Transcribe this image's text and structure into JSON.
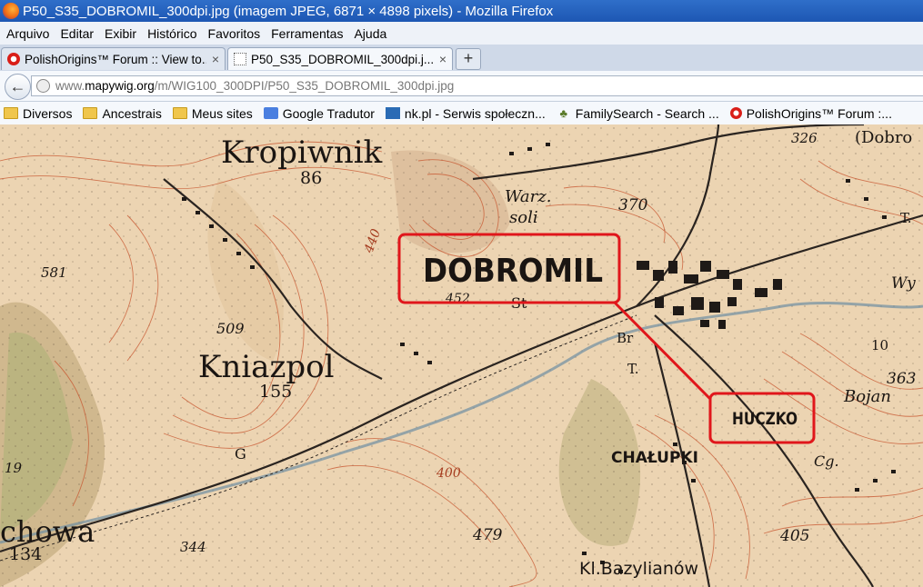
{
  "window": {
    "title": "P50_S35_DOBROMIL_300dpi.jpg (imagem JPEG, 6871 × 4898 pixels) - Mozilla Firefox"
  },
  "menu": [
    "Arquivo",
    "Editar",
    "Exibir",
    "Histórico",
    "Favoritos",
    "Ferramentas",
    "Ajuda"
  ],
  "tabs": [
    {
      "label": "PolishOrigins™ Forum :: View to...",
      "close": "×"
    },
    {
      "label": "P50_S35_DOBROMIL_300dpi.j...",
      "close": "×"
    }
  ],
  "new_tab": "+",
  "nav": {
    "back": "←",
    "url_pre": "www.",
    "url_domain": "mapywig.org",
    "url_path": "/m/WIG100_300DPI/P50_S35_DOBROMIL_300dpi.jpg"
  },
  "bookmarks": [
    {
      "label": "Diversos",
      "icon": "folder-icon"
    },
    {
      "label": "Ancestrais",
      "icon": "folder-icon"
    },
    {
      "label": "Meus sites",
      "icon": "folder-icon"
    },
    {
      "label": "Google Tradutor",
      "icon": "google-translate-icon"
    },
    {
      "label": "nk.pl - Serwis społeczn...",
      "icon": "nk-icon"
    },
    {
      "label": "FamilySearch - Search ...",
      "icon": "familysearch-icon"
    },
    {
      "label": "PolishOrigins™ Forum :...",
      "icon": "polishorigins-icon"
    }
  ],
  "map": {
    "labels": {
      "kropiwnik": "Kropiwnik",
      "k86": "86",
      "kniazpol": "Kniazpol",
      "k155": "155",
      "chowa": "chowa",
      "c134": "134",
      "dobromil": "DOBROMIL",
      "huczko": "HUCZKO",
      "chalupki": "CHAŁUPKI",
      "bazylianow": "Kl.Bazylianów",
      "warz": "Warz.",
      "soli": "soli",
      "dobro": "(Dobro",
      "n326": "326",
      "n370": "370",
      "n440": "440",
      "n581": "581",
      "n509": "509",
      "n452": "452",
      "st": "St",
      "br": "Br",
      "t1": "T.",
      "t2": "T.",
      "n479": "479",
      "n344": "344",
      "n405": "405",
      "n363": "363",
      "n10": "10",
      "bojan": "Bojan",
      "cg": "Cg.",
      "g": "G",
      "n19": "19",
      "wy": "Wy",
      "n400": "400"
    },
    "highlight_color": "#e0161b"
  }
}
